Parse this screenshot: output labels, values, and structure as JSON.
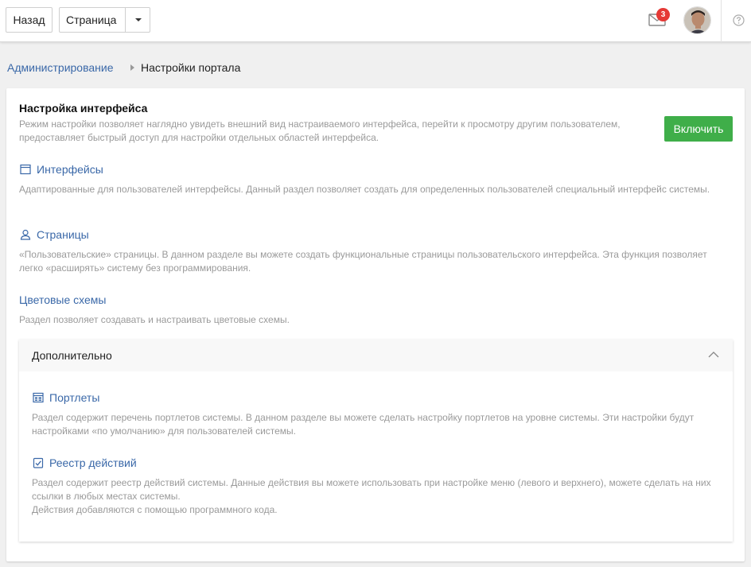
{
  "topbar": {
    "back_label": "Назад",
    "page_label": "Страница",
    "notification_count": "3"
  },
  "breadcrumb": {
    "parent": "Администрирование",
    "current": "Настройки портала"
  },
  "interface_settings": {
    "title": "Настройка интерфейса",
    "description": "Режим настройки позволяет наглядно увидеть внешний вид настраиваемого интерфейса, перейти к просмотру другим пользователем, предоставляет быстрый доступ для настройки отдельных областей интерфейса.",
    "enable_label": "Включить",
    "accent_color": "#3fae49"
  },
  "sections": [
    {
      "title": "Интерфейсы",
      "icon": "window-icon",
      "description": "Адаптированные для пользователей интерфейсы. Данный раздел позволяет создать для определенных пользователей специальный интерфейс системы."
    },
    {
      "title": "Страницы",
      "icon": "user-icon",
      "description": "«Пользовательские» страницы. В данном разделе вы можете создать функциональные страницы пользовательского интерфейса. Эта функция позволяет легко «расширять» систему без программирования."
    },
    {
      "title": "Цветовые схемы",
      "icon": "",
      "description": "Раздел позволяет создавать и настраивать цветовые схемы."
    }
  ],
  "additional": {
    "title": "Дополнительно",
    "items": [
      {
        "title": "Портлеты",
        "icon": "portlets-icon",
        "description": "Раздел содержит перечень портлетов системы. В данном разделе вы можете сделать настройку портлетов на уровне системы. Эти настройки будут настройками «по умолчанию» для пользователей системы."
      },
      {
        "title": "Реестр действий",
        "icon": "checklist-icon",
        "description": "Раздел содержит реестр действий системы. Данные действия вы можете использовать при настройке меню (левого и верхнего), можете сделать на них ссылки в любых местах системы.",
        "description_extra": "Действия добавляются с помощью программного кода."
      }
    ]
  },
  "colors": {
    "link": "#3a68a8",
    "muted_text": "#9a9a9a",
    "badge": "#e53935"
  }
}
